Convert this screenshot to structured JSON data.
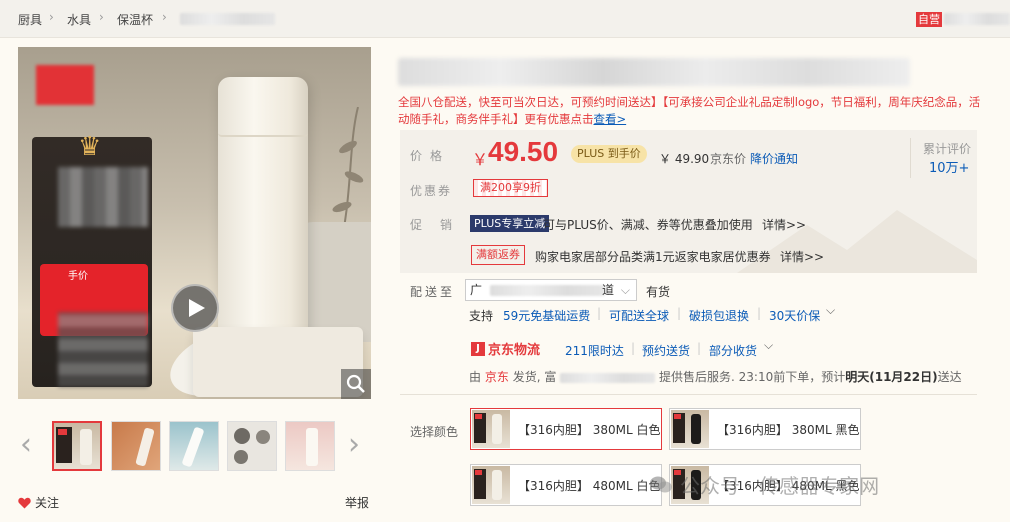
{
  "breadcrumb": {
    "items": [
      "厨具",
      "水具",
      "保温杯"
    ],
    "separator": "›",
    "shop_badge": "自营"
  },
  "gallery": {
    "promo_overlay_text": "手价",
    "thumbnail_count": 5,
    "follow_label": "关注",
    "report_label": "举报"
  },
  "product": {
    "subtitle_red": "全国八仓配送，快至可当次日达，可预约时间送达】【可承接公司企业礼品定制logo，节日福利，周年庆纪念品，活动随手礼，商务伴手礼】更有优惠点击",
    "subtitle_link": "查看>"
  },
  "price": {
    "label": "价格",
    "symbol": "￥",
    "value": "49.50",
    "plus_badge": "PLUS 到手价",
    "jd_price": "￥ 49.90",
    "jd_price_label": "京东价",
    "notify": "降价通知",
    "eval_label": "累计评价",
    "eval_count": "10万+"
  },
  "coupon": {
    "label": "优惠券",
    "value": "满200享9折"
  },
  "promotion": {
    "label": "促销",
    "plus_tag": "PLUS专享立减",
    "plus_text": "可与PLUS价、满减、券等优惠叠加使用",
    "detail1": "详情>>",
    "fanquan_tag": "满额返券",
    "fanquan_text": "购家电家居部分品类满1元返家电家居优惠券",
    "detail2": "详情>>"
  },
  "shipping": {
    "label": "配送至",
    "address": "广",
    "address_tail": "道",
    "stock": "有货",
    "support_label": "支持",
    "services": [
      "59元免基础运费",
      "可配送全球",
      "破损包退换",
      "30天价保"
    ],
    "logistics_brand": "京东物流",
    "delivery_options": [
      "211限时达",
      "预约送货",
      "部分收货"
    ],
    "info_prefix": "由",
    "info_jd": "京东",
    "info_mid": "发货,",
    "info_blur_head": "富",
    "info_after": "提供售后服务. 23:10前下单，预计",
    "info_date": "明天(11月22日)",
    "info_end": "送达"
  },
  "colors": {
    "label": "选择颜色",
    "options": [
      "【316内胆】 380ML 白色",
      "【316内胆】 380ML 黑色",
      "【316内胆】 480ML 白色",
      "【316内胆】 480ML 黑色"
    ],
    "selected_index": 0
  },
  "watermark": "公众号 · 传感器专家网",
  "palette": {
    "accent_red": "#e4393c",
    "link_blue": "#0b5bb7",
    "price_box_bg": "#f3f0ea",
    "page_bg": "#fdfaf3"
  }
}
